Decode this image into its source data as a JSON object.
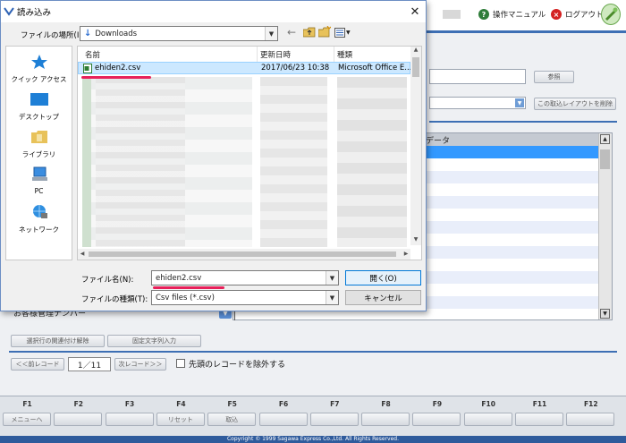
{
  "app": {
    "manual_link": "操作マニュアル",
    "logout_link": "ログアウト",
    "reference_button": "参照",
    "delete_layout_button": "この取込レイアウトを削除",
    "grid_header": "データ",
    "customer_field_label": "お客様管理ナンバー",
    "unlink_button": "選択行の関連付け解除",
    "fixed_text_button": "固定文字列入力",
    "prev_record_button": "＜＜前レコード",
    "record_pager": "1／11",
    "next_record_button": "次レコード＞＞",
    "exclude_first_record_label": "先頭のレコードを除外する",
    "fkeys": [
      {
        "key": "F1",
        "label": "メニューへ"
      },
      {
        "key": "F2",
        "label": ""
      },
      {
        "key": "F3",
        "label": ""
      },
      {
        "key": "F4",
        "label": "リセット"
      },
      {
        "key": "F5",
        "label": "取込"
      },
      {
        "key": "F6",
        "label": ""
      },
      {
        "key": "F7",
        "label": ""
      },
      {
        "key": "F8",
        "label": ""
      },
      {
        "key": "F9",
        "label": ""
      },
      {
        "key": "F10",
        "label": ""
      },
      {
        "key": "F11",
        "label": ""
      },
      {
        "key": "F12",
        "label": ""
      }
    ],
    "copyright": "Copyright © 1999 Sagawa Express Co.,Ltd. All Rights Reserved."
  },
  "dialog": {
    "title": "読み込み",
    "close_glyph": "✕",
    "location_label": "ファイルの場所(I):",
    "location_value": "Downloads",
    "nav_items": [
      "クイック アクセス",
      "デスクトップ",
      "ライブラリ",
      "PC",
      "ネットワーク"
    ],
    "columns": [
      "名前",
      "更新日時",
      "種類"
    ],
    "selected_file": {
      "name": "ehiden2.csv",
      "modified": "2017/06/23 10:38",
      "type": "Microsoft Office E..."
    },
    "filename_label": "ファイル名(N):",
    "filename_value": "ehiden2.csv",
    "filetype_label": "ファイルの種類(T):",
    "filetype_value": "Csv files (*.csv)",
    "open_button": "開く(O)",
    "cancel_button": "キャンセル"
  },
  "colors": {
    "accent_blue": "#3d6fb4",
    "selection": "#cce8ff",
    "highlight_underline": "#e8205a",
    "grid_selected_row": "#3399ff"
  }
}
